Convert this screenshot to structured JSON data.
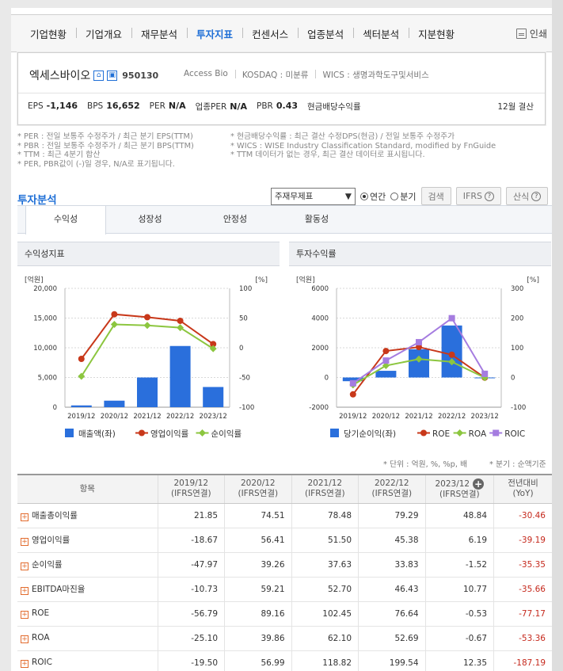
{
  "nav": {
    "tabs": [
      "기업현황",
      "기업개요",
      "재무분석",
      "투자지표",
      "컨센서스",
      "업종분석",
      "섹터분석",
      "지분현황"
    ],
    "active": 3,
    "print_label": "인쇄"
  },
  "company": {
    "name": "엑세스바이오",
    "code": "950130",
    "info": [
      "Access Bio",
      "KOSDAQ : 미분류",
      "WICS : 생명과학도구및서비스"
    ],
    "metrics": [
      {
        "label": "EPS",
        "value": "-1,146"
      },
      {
        "label": "BPS",
        "value": "16,652"
      },
      {
        "label": "PER",
        "value": "N/A"
      },
      {
        "label": "업종PER",
        "value": "N/A"
      },
      {
        "label": "PBR",
        "value": "0.43"
      },
      {
        "label": "현금배당수익률",
        "value": ""
      }
    ],
    "settlement": "12월 결산"
  },
  "notes_left": [
    "* PER : 전일 보통주 수정주가 / 최근 분기 EPS(TTM)",
    "* PBR : 전일 보통주 수정주가 / 최근 분기 BPS(TTM)",
    "* TTM : 최근 4분기 합산",
    "* PER, PBR값이 (-)일 경우, N/A로 표기됩니다."
  ],
  "notes_right": [
    "* 현금배당수익률 : 최근 결산 수정DPS(현금) / 전일 보통주 수정주가",
    "* WICS : WISE Industry Classification Standard, modified by FnGuide",
    "* TTM 데이터가 없는 경우, 최근 결산 데이터로 표시됩니다."
  ],
  "analysis": {
    "title": "투자분석",
    "select_value": "주재무제표",
    "radio_annual": "연간",
    "radio_quarter": "분기",
    "search_label": "검색",
    "ifrs_label": "IFRS",
    "formula_label": "산식",
    "subtabs": [
      "수익성",
      "성장성",
      "안정성",
      "활동성"
    ]
  },
  "chart_data": [
    {
      "type": "bar",
      "title": "수익성지표",
      "categories": [
        "2019/12",
        "2020/12",
        "2021/12",
        "2022/12",
        "2023/12"
      ],
      "ylabel_left": "[억원]",
      "ylabel_right": "[%]",
      "ylim_left": [
        0,
        20000
      ],
      "ylim_right": [
        -100,
        100
      ],
      "yticks_left": [
        "20,000",
        "15,000",
        "10,000",
        "5,000",
        "0"
      ],
      "yticks_right": [
        "100",
        "50",
        "0",
        "-50",
        "-100"
      ],
      "series": [
        {
          "name": "매출액(좌)",
          "kind": "bar",
          "axis": "left",
          "color": "#2a6fdc",
          "values": [
            300,
            1100,
            5000,
            10300,
            3400
          ]
        },
        {
          "name": "영업이익률",
          "kind": "line",
          "axis": "right",
          "color": "#c8381a",
          "values": [
            -18.67,
            56.41,
            51.5,
            45.38,
            6.19
          ]
        },
        {
          "name": "순이익률",
          "kind": "line",
          "axis": "right",
          "color": "#8cc63f",
          "values": [
            -47.97,
            39.26,
            37.63,
            33.83,
            -1.52
          ]
        }
      ]
    },
    {
      "type": "bar",
      "title": "투자수익률",
      "categories": [
        "2019/12",
        "2020/12",
        "2021/12",
        "2022/12",
        "2023/12"
      ],
      "ylabel_left": "[억원]",
      "ylabel_right": "[%]",
      "ylim_left": [
        -2000,
        6000
      ],
      "ylim_right": [
        -100,
        300
      ],
      "yticks_left": [
        "6000",
        "4000",
        "2000",
        "0",
        "-2000"
      ],
      "yticks_right": [
        "300",
        "200",
        "100",
        "0",
        "-100"
      ],
      "series": [
        {
          "name": "당기순이익(좌)",
          "kind": "bar",
          "axis": "left",
          "color": "#2a6fdc",
          "values": [
            -250,
            450,
            1900,
            3500,
            -50
          ]
        },
        {
          "name": "ROE",
          "kind": "line",
          "axis": "right",
          "color": "#c8381a",
          "values": [
            -56.79,
            89.16,
            102.45,
            76.64,
            -0.53
          ]
        },
        {
          "name": "ROA",
          "kind": "line",
          "axis": "right",
          "color": "#8cc63f",
          "values": [
            -25.1,
            39.86,
            62.1,
            52.69,
            -0.67
          ]
        },
        {
          "name": "ROIC",
          "kind": "line",
          "axis": "right",
          "color": "#a57ce0",
          "values": [
            -19.5,
            56.99,
            118.82,
            199.54,
            12.35
          ]
        }
      ]
    }
  ],
  "table": {
    "unit_note": "* 단위 : 억원, %, %p, 배",
    "quarter_note": "* 분기 : 순액기준",
    "header_item": "항목",
    "columns": [
      {
        "year": "2019/12",
        "type": "(IFRS연결)"
      },
      {
        "year": "2020/12",
        "type": "(IFRS연결)"
      },
      {
        "year": "2021/12",
        "type": "(IFRS연결)"
      },
      {
        "year": "2022/12",
        "type": "(IFRS연결)"
      },
      {
        "year": "2023/12",
        "type": "(IFRS연결)"
      },
      {
        "year": "전년대비",
        "type": "(YoY)"
      }
    ],
    "rows": [
      {
        "label": "매출총이익률",
        "values": [
          "21.85",
          "74.51",
          "78.48",
          "79.29",
          "48.84",
          "-30.46"
        ]
      },
      {
        "label": "영업이익률",
        "values": [
          "-18.67",
          "56.41",
          "51.50",
          "45.38",
          "6.19",
          "-39.19"
        ]
      },
      {
        "label": "순이익률",
        "values": [
          "-47.97",
          "39.26",
          "37.63",
          "33.83",
          "-1.52",
          "-35.35"
        ]
      },
      {
        "label": "EBITDA마진율",
        "values": [
          "-10.73",
          "59.21",
          "52.70",
          "46.43",
          "10.77",
          "-35.66"
        ]
      },
      {
        "label": "ROE",
        "values": [
          "-56.79",
          "89.16",
          "102.45",
          "76.64",
          "-0.53",
          "-77.17"
        ]
      },
      {
        "label": "ROA",
        "values": [
          "-25.10",
          "39.86",
          "62.10",
          "52.69",
          "-0.67",
          "-53.36"
        ]
      },
      {
        "label": "ROIC",
        "values": [
          "-19.50",
          "56.99",
          "118.82",
          "199.54",
          "12.35",
          "-187.19"
        ]
      }
    ]
  }
}
